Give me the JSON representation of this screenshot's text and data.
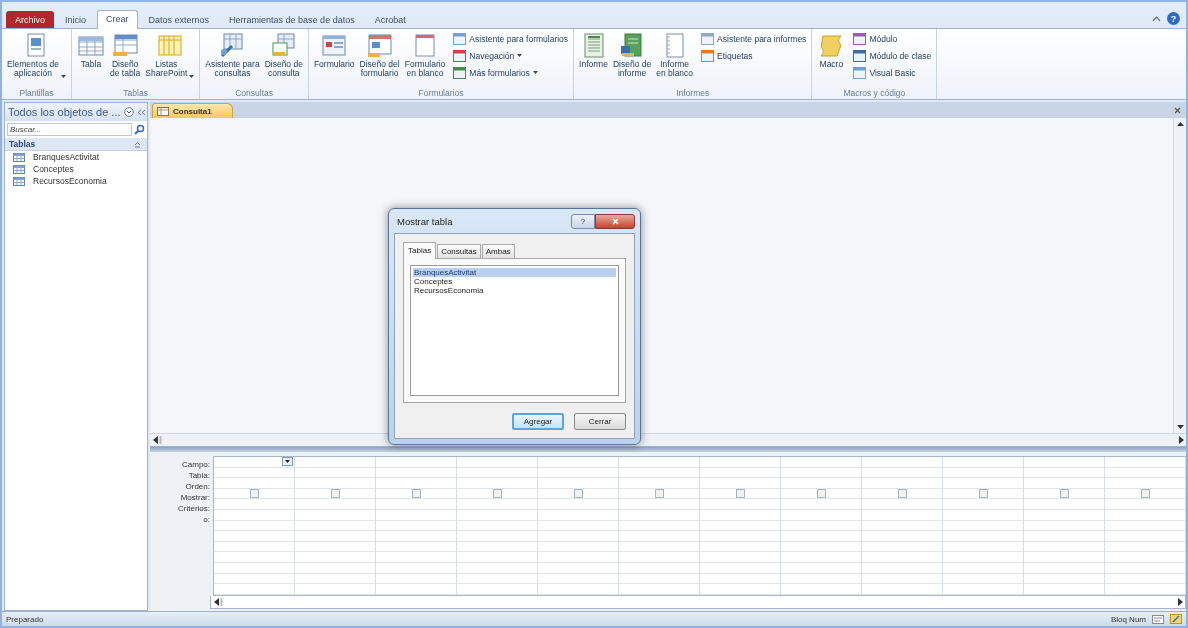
{
  "ribbon_tabs": [
    {
      "label": "Archivo",
      "kind": "file",
      "selected": false
    },
    {
      "label": "Inicio",
      "kind": "tab",
      "selected": false
    },
    {
      "label": "Crear",
      "kind": "tab",
      "selected": true
    },
    {
      "label": "Datos externos",
      "kind": "tab",
      "selected": false
    },
    {
      "label": "Herramientas de base de datos",
      "kind": "tab",
      "selected": false
    },
    {
      "label": "Acrobat",
      "kind": "tab",
      "selected": false
    }
  ],
  "help_button": "?",
  "ribbon_groups": [
    {
      "title": "Plantillas",
      "buttons": [
        {
          "kind": "large",
          "label": "Elementos de\naplicación",
          "dropdown": true
        }
      ]
    },
    {
      "title": "Tablas",
      "buttons": [
        {
          "kind": "large",
          "label": "Tabla",
          "dropdown": false
        },
        {
          "kind": "large",
          "label": "Diseño\nde tabla",
          "dropdown": false
        },
        {
          "kind": "large",
          "label": "Listas\nSharePoint",
          "dropdown": true
        }
      ]
    },
    {
      "title": "Consultas",
      "buttons": [
        {
          "kind": "large",
          "label": "Asistente para\nconsultas",
          "dropdown": false
        },
        {
          "kind": "large",
          "label": "Diseño de\nconsulta",
          "dropdown": false
        }
      ]
    },
    {
      "title": "Formularios",
      "buttons": [
        {
          "kind": "large",
          "label": "Formulario",
          "dropdown": false
        },
        {
          "kind": "large",
          "label": "Diseño del\nformulario",
          "dropdown": false
        },
        {
          "kind": "large",
          "label": "Formulario\nen blanco",
          "dropdown": false
        },
        {
          "kind": "small",
          "label": "Asistente para formularios",
          "dropdown": false
        },
        {
          "kind": "small",
          "label": "Navegación",
          "dropdown": true
        },
        {
          "kind": "small",
          "label": "Más formularios",
          "dropdown": true
        }
      ]
    },
    {
      "title": "Informes",
      "buttons": [
        {
          "kind": "large",
          "label": "Informe",
          "dropdown": false
        },
        {
          "kind": "large",
          "label": "Diseño de\ninforme",
          "dropdown": false
        },
        {
          "kind": "large",
          "label": "Informe\nen blanco",
          "dropdown": false
        },
        {
          "kind": "small",
          "label": "Asistente para informes",
          "dropdown": false
        },
        {
          "kind": "small",
          "label": "Etiquetas",
          "dropdown": false
        }
      ]
    },
    {
      "title": "Macros y código",
      "buttons": [
        {
          "kind": "large",
          "label": "Macro",
          "dropdown": false
        },
        {
          "kind": "small",
          "label": "Módulo",
          "dropdown": false
        },
        {
          "kind": "small",
          "label": "Módulo de clase",
          "dropdown": false
        },
        {
          "kind": "small",
          "label": "Visual Basic",
          "dropdown": false
        }
      ]
    }
  ],
  "navigation_pane": {
    "title": "Todos los objetos de ...",
    "search": {
      "placeholder": "Buscar..."
    },
    "section": "Tablas",
    "items": [
      {
        "label": "BranquesActivitat"
      },
      {
        "label": "Conceptes"
      },
      {
        "label": "RecursosEconomia"
      }
    ]
  },
  "document_tab": {
    "label": "Consulta1"
  },
  "dialog": {
    "title": "Mostrar tabla",
    "tabs": [
      {
        "label": "Tablas",
        "selected": true
      },
      {
        "label": "Consultas",
        "selected": false
      },
      {
        "label": "Ambas",
        "selected": false
      }
    ],
    "list": [
      {
        "label": "BranquesActivitat",
        "selected": true
      },
      {
        "label": "Conceptes",
        "selected": false
      },
      {
        "label": "RecursosEconomia",
        "selected": false
      }
    ],
    "buttons": [
      {
        "label": "Agregar",
        "default": true
      },
      {
        "label": "Cerrar",
        "default": false
      }
    ]
  },
  "query_grid": {
    "row_labels": [
      "Campo:",
      "Tabla:",
      "Orden:",
      "Mostrar:",
      "Criterios:",
      "o:"
    ],
    "columns": [
      {
        "selected": true,
        "show_checked": false
      },
      {
        "selected": false,
        "show_checked": false
      },
      {
        "selected": false,
        "show_checked": false
      },
      {
        "selected": false,
        "show_checked": false
      },
      {
        "selected": false,
        "show_checked": false
      },
      {
        "selected": false,
        "show_checked": false
      },
      {
        "selected": false,
        "show_checked": false
      },
      {
        "selected": false,
        "show_checked": false
      },
      {
        "selected": false,
        "show_checked": false
      },
      {
        "selected": false,
        "show_checked": false
      },
      {
        "selected": false,
        "show_checked": false
      },
      {
        "selected": false,
        "show_checked": false
      }
    ]
  },
  "status_bar": {
    "left": "Preparado",
    "right": "Bloq Num"
  }
}
